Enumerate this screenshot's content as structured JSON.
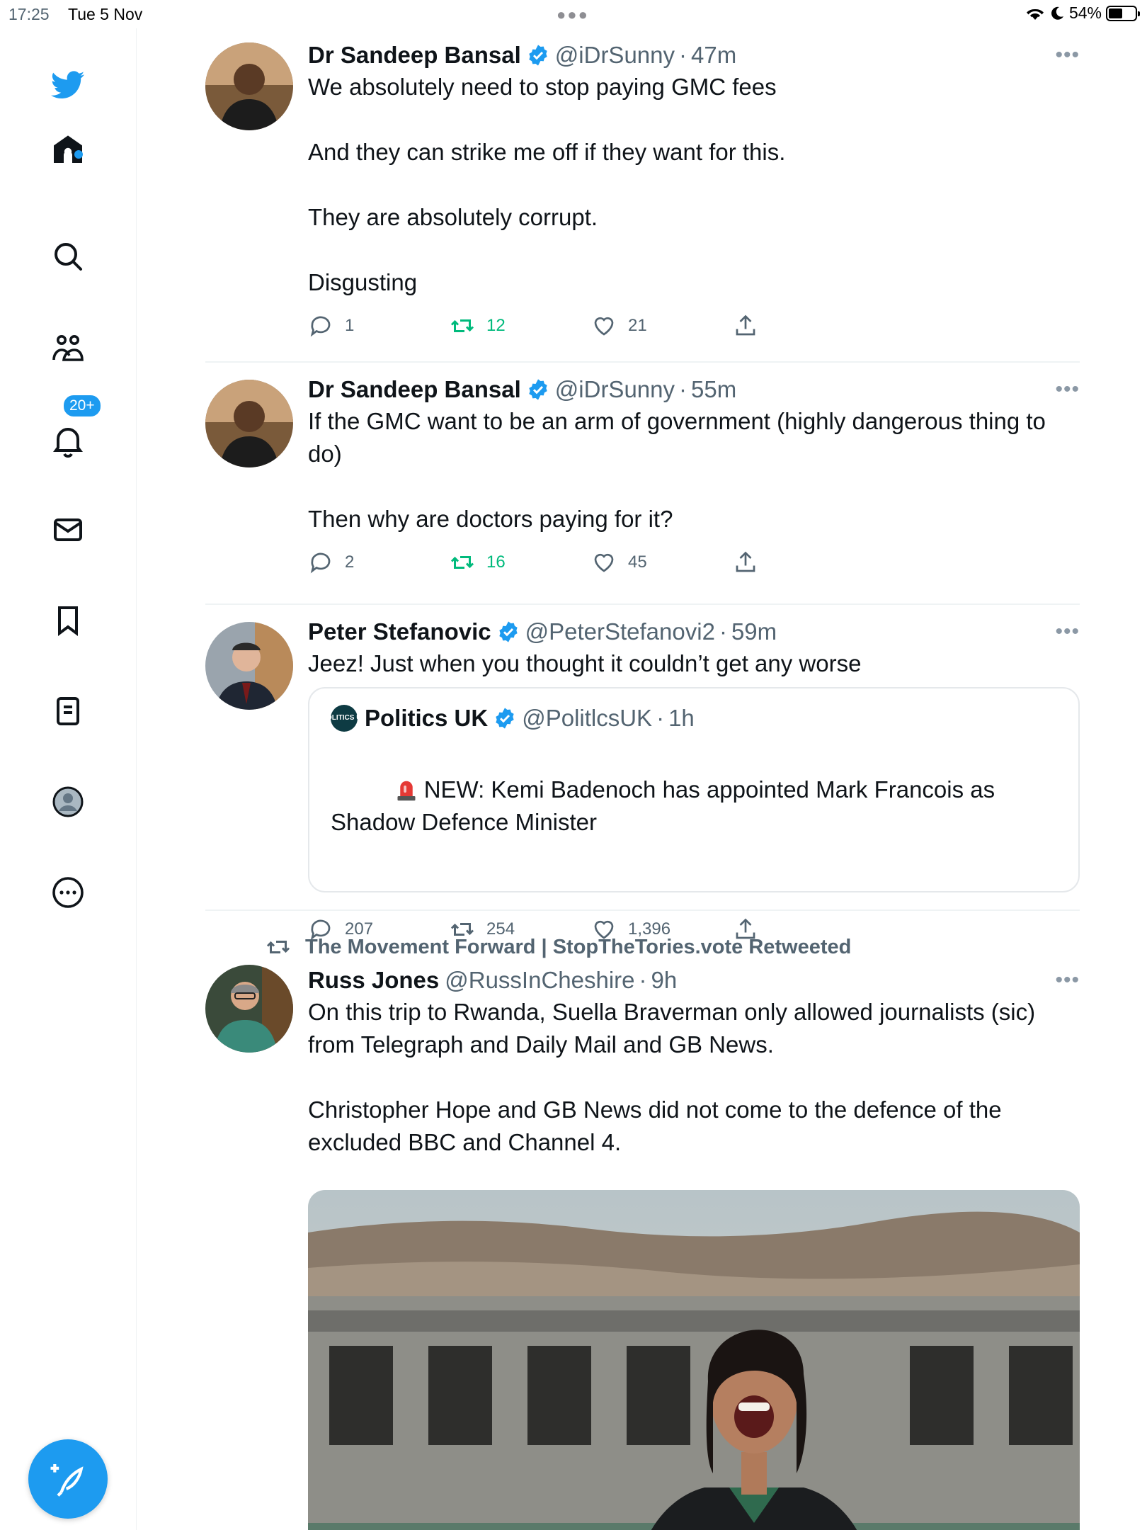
{
  "status_bar": {
    "time": "17:25",
    "date": "Tue 5 Nov",
    "battery": "54%",
    "battery_level": 0.54
  },
  "sidebar": {
    "notifications_badge": "20+",
    "items": [
      "home-icon",
      "search-icon",
      "communities-icon",
      "notifications-icon",
      "messages-icon",
      "bookmarks-icon",
      "lists-icon",
      "profile-icon",
      "more-icon"
    ]
  },
  "tweets": [
    {
      "name": "Dr Sandeep Bansal",
      "handle": "@iDrSunny",
      "sep": "·",
      "time": "47m",
      "text": "We absolutely need to stop paying GMC fees\n\nAnd they can strike me off if they want for this.\n\nThey are absolutely corrupt.\n\nDisgusting",
      "replies": "1",
      "retweets": "12",
      "likes": "21",
      "retweeted_by_me": true
    },
    {
      "name": "Dr Sandeep Bansal",
      "handle": "@iDrSunny",
      "sep": "·",
      "time": "55m",
      "text": "If the GMC want to be an arm of government (highly dangerous thing to do)\n\nThen why are doctors paying for it?",
      "replies": "2",
      "retweets": "16",
      "likes": "45",
      "retweeted_by_me": true
    },
    {
      "name": "Peter Stefanovic",
      "handle": "@PeterStefanovi2",
      "sep": "·",
      "time": "59m",
      "text": "Jeez! Just when you thought it couldn’t get any worse",
      "quote": {
        "logo_text": "POLITICS UK",
        "name": "Politics UK",
        "handle": "@PolitlcsUK",
        "sep": "·",
        "time": "1h",
        "text": "NEW: Kemi Badenoch has appointed Mark Francois as Shadow Defence Minister"
      },
      "replies": "207",
      "retweets": "254",
      "likes": "1,396"
    },
    {
      "retweeted_by": "The Movement Forward | StopTheTories.vote Retweeted",
      "name": "Russ Jones",
      "handle": "@RussInCheshire",
      "sep": "·",
      "time": "9h",
      "text": "On this trip to Rwanda, Suella Braverman only allowed journalists (sic) from Telegraph and Daily Mail and GB News.\n\nChristopher Hope and GB News did not come to the defence of the excluded BBC and Channel 4."
    }
  ],
  "colors": {
    "accent": "#1d9bf0",
    "retweet_green": "#00ba7c",
    "secondary_text": "#536471"
  }
}
